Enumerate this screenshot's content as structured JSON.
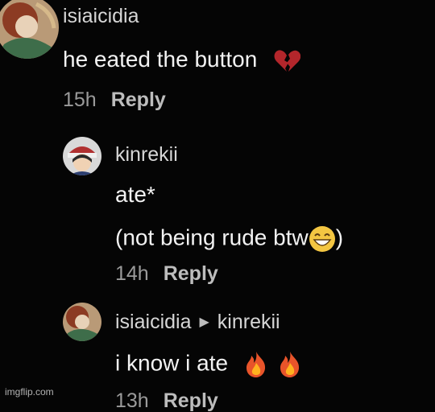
{
  "comments": [
    {
      "username": "isiaicidia",
      "text": "he eated the button",
      "emoji": "broken-heart-icon",
      "time": "15h",
      "reply_label": "Reply"
    },
    {
      "username": "kinrekii",
      "text_line1": "ate*",
      "text_line2": "(not being rude btw",
      "text_line2_end": ")",
      "emoji": "grinning-face-icon",
      "time": "14h",
      "reply_label": "Reply"
    },
    {
      "username": "isiaicidia",
      "reply_to": "kinrekii",
      "text": "i know i ate",
      "emojis": [
        "fire-icon",
        "fire-icon"
      ],
      "time": "13h",
      "reply_label": "Reply"
    }
  ],
  "watermark": "imgflip.com",
  "colors": {
    "background": "#050505",
    "username": "#d6d6d6",
    "text": "#f2f2f2",
    "meta": "#9a9a9a",
    "broken_heart": "#b3262b"
  }
}
